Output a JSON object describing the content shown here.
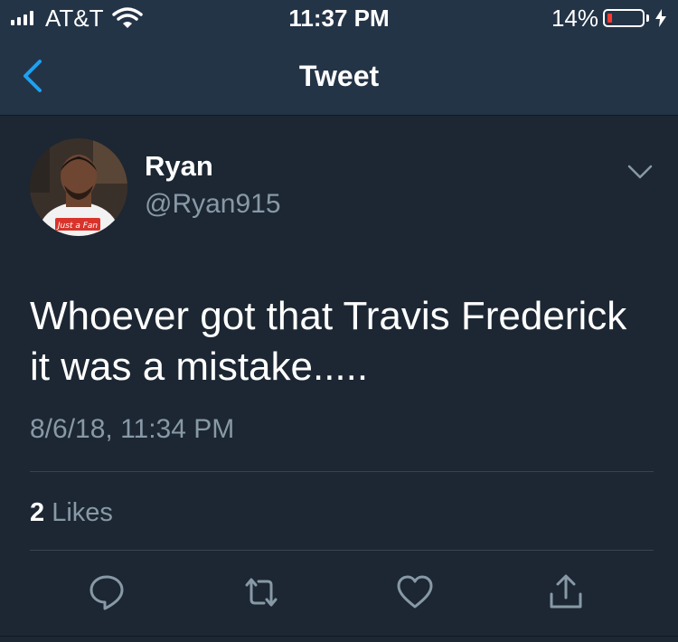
{
  "status_bar": {
    "carrier": "AT&T",
    "time": "11:37 PM",
    "battery_percent": "14%",
    "battery_level": 0.14,
    "icons": [
      "signal-icon",
      "wifi-icon",
      "battery-icon",
      "charging-icon"
    ]
  },
  "nav": {
    "title": "Tweet",
    "back_icon": "chevron-left-icon"
  },
  "tweet": {
    "display_name": "Ryan",
    "handle": "@Ryan915",
    "avatar_shirt_text": "Just a Fan",
    "text": "Whoever got that Travis Frederick it was a mistake.....",
    "timestamp": "8/6/18, 11:34 PM",
    "likes_count": "2",
    "likes_label": "Likes"
  },
  "actions": [
    "reply-icon",
    "retweet-icon",
    "like-icon",
    "share-icon"
  ],
  "colors": {
    "background": "#1c2733",
    "bar": "#243447",
    "accent": "#1da1f2",
    "secondary_text": "#8899a6",
    "divider": "#38444d",
    "battery_low": "#ff3b30"
  }
}
